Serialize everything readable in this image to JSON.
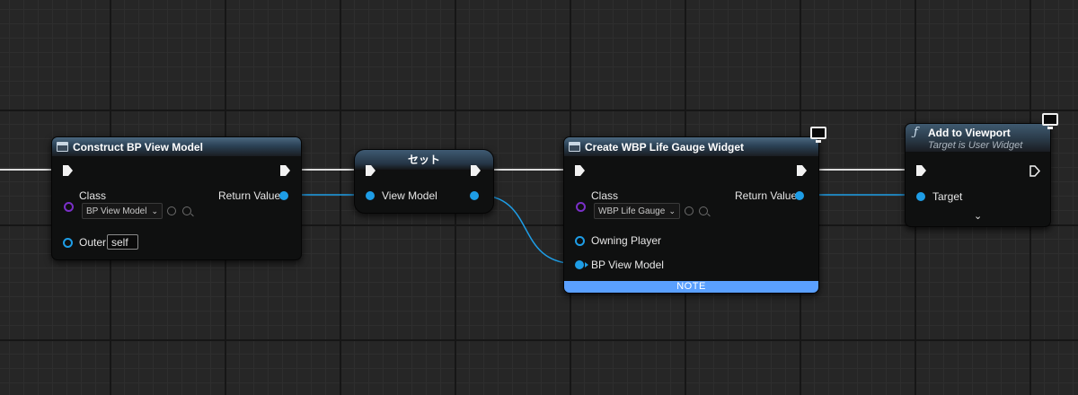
{
  "nodes": {
    "construct": {
      "title": "Construct BP View Model",
      "class_label": "Class",
      "class_value": "BP View Model",
      "return_label": "Return Value",
      "outer_label": "Outer",
      "outer_value": "self"
    },
    "set": {
      "title": "セット",
      "view_model_label": "View Model"
    },
    "create_widget": {
      "title": "Create WBP Life Gauge Widget",
      "class_label": "Class",
      "class_value": "WBP Life Gauge",
      "return_label": "Return Value",
      "owning_player_label": "Owning Player",
      "bp_view_model_label": "BP View Model",
      "note_label": "NOTE"
    },
    "add_viewport": {
      "title": "Add to Viewport",
      "subtitle": "Target is User Widget",
      "target_label": "Target"
    }
  },
  "colors": {
    "exec": "#f2f2f2",
    "object_pin": "#1e9de6",
    "class_pin": "#7a2fc8",
    "note_bar": "#5aa0ff"
  },
  "icons": [
    "function-icon",
    "monitor-icon",
    "chevron-down-icon",
    "search-icon",
    "reset-icon"
  ]
}
